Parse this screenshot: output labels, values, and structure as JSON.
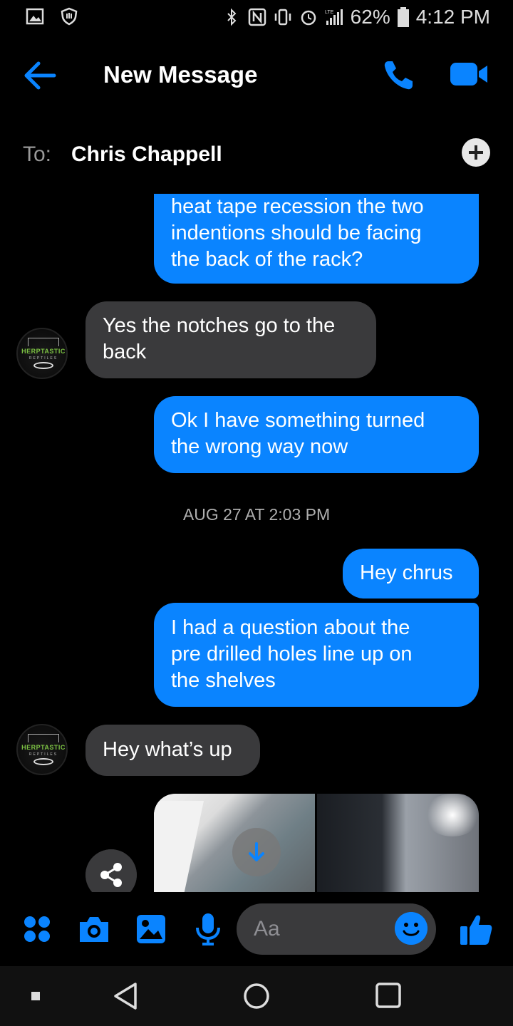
{
  "status_bar": {
    "battery": "62%",
    "time": "4:12 PM",
    "network": "LTE"
  },
  "header": {
    "title": "New Message"
  },
  "to": {
    "label": "To:",
    "name": "Chris Chappell"
  },
  "messages": [
    {
      "side": "out",
      "text_lines": [
        "heat tape recession the two",
        "indentions should be facing",
        "the back of the rack?"
      ]
    },
    {
      "side": "in",
      "text_lines": [
        "Yes the notches go to the",
        "back"
      ]
    },
    {
      "side": "out",
      "text_lines": [
        "Ok I have something turned",
        "the wrong way now"
      ]
    },
    {
      "side": "out",
      "text_lines": [
        "Hey chrus"
      ]
    },
    {
      "side": "out",
      "text_lines": [
        "I had a question about the",
        "pre drilled holes line up on",
        "the shelves"
      ]
    },
    {
      "side": "in",
      "text_lines": [
        "Hey what’s up"
      ]
    }
  ],
  "timestamp": "AUG 27 AT 2:03 PM",
  "avatar": {
    "brand": "HERPTASTIC",
    "sub": "REPTILES"
  },
  "composer": {
    "placeholder": "Aa"
  },
  "colors": {
    "outgoing_bubble": "#0a84ff",
    "incoming_bubble": "#3a3a3c",
    "accent": "#0a84ff"
  },
  "icons": {
    "back": "arrow-left-icon",
    "call": "phone-icon",
    "video": "video-camera-icon",
    "add": "plus-icon",
    "menu": "four-dots-icon",
    "camera": "camera-icon",
    "gallery": "image-icon",
    "mic": "microphone-icon",
    "emoji": "smiley-icon",
    "like": "thumbs-up-icon",
    "download": "arrow-down-icon",
    "share": "share-icon"
  }
}
